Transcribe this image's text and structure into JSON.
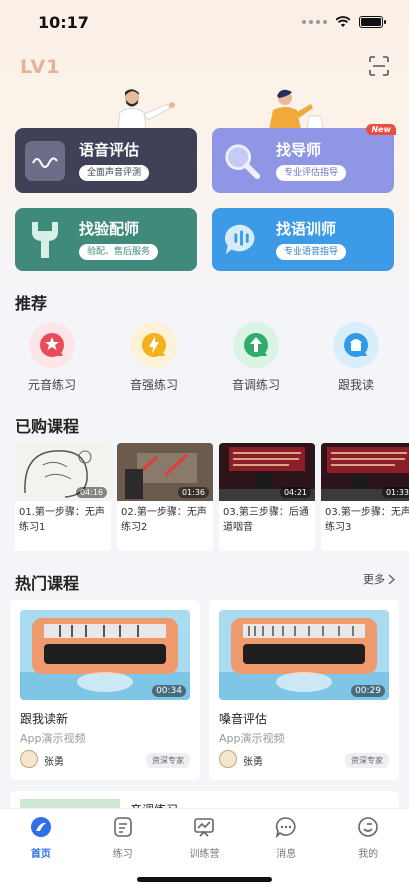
{
  "status": {
    "time": "10:17"
  },
  "header": {
    "level": "LV1"
  },
  "cards": [
    {
      "title": "语音评估",
      "pill": "全面声音评测",
      "color": "#3f4157"
    },
    {
      "title": "找导师",
      "pill": "专业评估指导",
      "color": "#8f96e6",
      "badge": "New"
    },
    {
      "title": "找验配师",
      "pill": "验配、售后服务",
      "color": "#3f8a7a"
    },
    {
      "title": "找语训师",
      "pill": "专业语音指导",
      "color": "#3c9ae6"
    }
  ],
  "sections": {
    "recommend": "推荐",
    "purchased": "已购课程",
    "hot": "热门课程",
    "more": "更多"
  },
  "recommend": [
    {
      "label": "元音练习",
      "color": "#e84c5a"
    },
    {
      "label": "音强练习",
      "color": "#f3b21c"
    },
    {
      "label": "音调练习",
      "color": "#2eae6a"
    },
    {
      "label": "跟我读",
      "color": "#2e9be8"
    }
  ],
  "purchased": [
    {
      "title": "01.第一步骤：无声练习1",
      "duration": "04:16"
    },
    {
      "title": "02.第一步骤：无声练习2",
      "duration": "01:36"
    },
    {
      "title": "03.第三步骤：后通道咽音",
      "duration": "04:21"
    },
    {
      "title": "03.第一步骤：无声练习3",
      "duration": "01:33"
    }
  ],
  "hot": [
    {
      "title": "跟我读新",
      "subtitle": "App演示视频",
      "duration": "00:34",
      "author": "张勇",
      "badge": "资深专家"
    },
    {
      "title": "嗓音评估",
      "subtitle": "App演示视频",
      "duration": "00:29",
      "author": "张勇",
      "badge": "资深专家"
    }
  ],
  "partial": {
    "title": "音调练习"
  },
  "tabs": [
    {
      "label": "首页",
      "icon": "home-icon",
      "active": true
    },
    {
      "label": "练习",
      "icon": "practice-icon"
    },
    {
      "label": "训练营",
      "icon": "camp-icon"
    },
    {
      "label": "消息",
      "icon": "message-icon"
    },
    {
      "label": "我的",
      "icon": "profile-icon"
    }
  ],
  "colors": {
    "accent": "#2f6fe8",
    "level": "#e2b59a"
  }
}
